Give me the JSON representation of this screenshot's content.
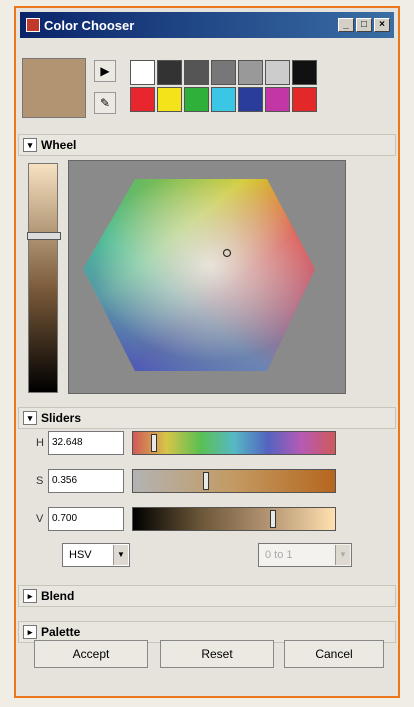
{
  "window": {
    "title": "Color Chooser",
    "controls": {
      "minimize": "_",
      "maximize": "□",
      "close": "×"
    }
  },
  "current_color": "#b39472",
  "tools": {
    "play_icon": "▶",
    "eyedropper_icon": "✎"
  },
  "palette": [
    "#ffffff",
    "#333333",
    "#555555",
    "#777777",
    "#999999",
    "#cccccc",
    "#111111",
    "#e8262d",
    "#f4e21b",
    "#2eb03a",
    "#3cc6e6",
    "#2a3d9a",
    "#c236a6",
    "#e3282a"
  ],
  "sections": {
    "wheel": {
      "label": "Wheel",
      "toggle": "▾"
    },
    "sliders": {
      "label": "Sliders",
      "toggle": "▾"
    },
    "blend": {
      "label": "Blend",
      "toggle": "▸"
    },
    "palette": {
      "label": "Palette",
      "toggle": "▸"
    }
  },
  "value_bar_level": 0.3,
  "sliders": {
    "h": {
      "label": "H",
      "value": "32.648",
      "fraction": 0.09
    },
    "s": {
      "label": "S",
      "value": "0.356",
      "fraction": 0.356
    },
    "v": {
      "label": "V",
      "value": "0.700",
      "fraction": 0.7
    }
  },
  "mode": {
    "selected": "HSV"
  },
  "range": {
    "selected": "0 to 1"
  },
  "buttons": {
    "accept": "Accept",
    "reset": "Reset",
    "cancel": "Cancel"
  }
}
